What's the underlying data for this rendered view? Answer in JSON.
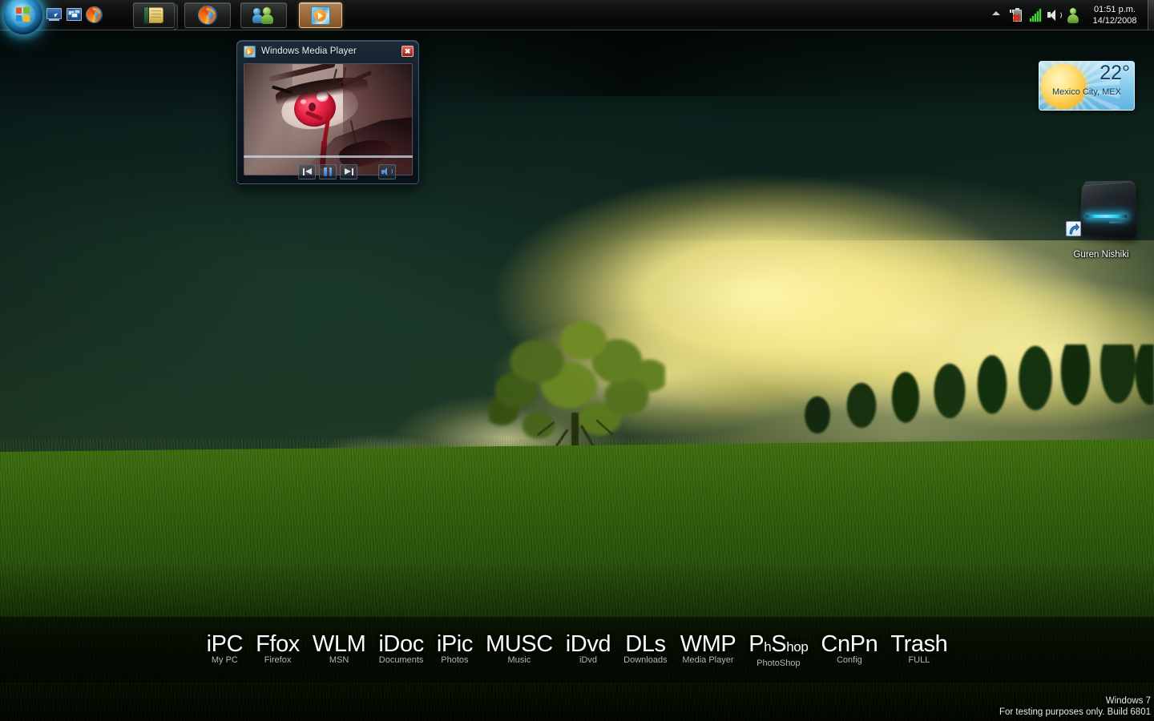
{
  "taskbar": {
    "start_button": {
      "label": "Start",
      "icon": "windows-orb-icon"
    },
    "quick_launch": [
      {
        "name": "show-desktop",
        "label": "Show Desktop",
        "icon": "show-desktop-icon"
      },
      {
        "name": "switch-windows",
        "label": "Switch between windows",
        "icon": "switch-windows-icon"
      },
      {
        "name": "firefox",
        "label": "Mozilla Firefox",
        "icon": "firefox-icon"
      }
    ],
    "buttons": [
      {
        "name": "explorer",
        "label": "Windows Explorer",
        "icon": "folder-icon",
        "active": false,
        "stacked": true
      },
      {
        "name": "firefox",
        "label": "Mozilla Firefox",
        "icon": "firefox-icon",
        "active": false,
        "stacked": false
      },
      {
        "name": "wlm",
        "label": "Windows Live Messenger",
        "icon": "messenger-icon",
        "active": false,
        "stacked": false
      },
      {
        "name": "wmp",
        "label": "Windows Media Player",
        "icon": "media-player-icon",
        "active": true,
        "stacked": false
      }
    ],
    "tray": {
      "overflow_label": "Show hidden icons",
      "icons": [
        {
          "name": "battery",
          "label": "Battery not present",
          "icon": "battery-error-icon",
          "badge": "✕"
        },
        {
          "name": "network",
          "label": "Network",
          "icon": "signal-bars-icon"
        },
        {
          "name": "volume",
          "label": "Volume",
          "icon": "speaker-icon"
        },
        {
          "name": "user",
          "label": "User account",
          "icon": "person-icon"
        }
      ]
    },
    "clock": {
      "time": "01:51 p.m.",
      "date": "14/12/2008"
    }
  },
  "media_player_window": {
    "title": "Windows Media Player",
    "title_icon": "media-player-icon",
    "close_label": "✖",
    "thumbnail_alt": "anime-eye-video-frame",
    "controls": [
      {
        "name": "previous",
        "label": "Previous",
        "icon": "previous-track-icon"
      },
      {
        "name": "pause",
        "label": "Pause",
        "icon": "pause-icon"
      },
      {
        "name": "next",
        "label": "Next",
        "icon": "next-track-icon"
      },
      {
        "name": "volume",
        "label": "Volume",
        "icon": "speaker-icon"
      }
    ]
  },
  "weather_gadget": {
    "temperature": "22°",
    "location": "Mexico City, MEX",
    "condition_icon": "sun-icon"
  },
  "desktop_icons": [
    {
      "name": "guren-nishiki",
      "label": "Guren Nishiki",
      "icon": "external-hard-drive-icon",
      "shortcut": true
    }
  ],
  "dock": {
    "items": [
      {
        "name": "my-pc",
        "title": "iPC",
        "title_small": "",
        "subtitle": "My PC"
      },
      {
        "name": "firefox",
        "title": "Ffox",
        "title_small": "",
        "subtitle": "Firefox"
      },
      {
        "name": "msn",
        "title": "WLM",
        "title_small": "",
        "subtitle": "MSN"
      },
      {
        "name": "documents",
        "title": "iDoc",
        "title_small": "",
        "subtitle": "Documents"
      },
      {
        "name": "photos",
        "title": "iPic",
        "title_small": "",
        "subtitle": "Photos"
      },
      {
        "name": "music",
        "title": "MUSC",
        "title_small": "",
        "subtitle": "Music"
      },
      {
        "name": "idvd",
        "title": "iDvd",
        "title_small": "",
        "subtitle": "iDvd"
      },
      {
        "name": "downloads",
        "title": "DLs",
        "title_small": "",
        "subtitle": "Downloads"
      },
      {
        "name": "media-player",
        "title": "WMP",
        "title_small": "",
        "subtitle": "Media Player"
      },
      {
        "name": "photoshop",
        "title": "P",
        "title_small": "h",
        "subtitle": "PhotoShop",
        "title2": "S",
        "title_small2": "hop"
      },
      {
        "name": "config",
        "title": "CnPn",
        "title_small": "",
        "subtitle": "Config"
      },
      {
        "name": "trash",
        "title": "Trash",
        "title_small": "",
        "subtitle": "FULL"
      }
    ]
  },
  "watermark": {
    "line1": "Windows  7",
    "line2": "For testing purposes only. Build 6801"
  },
  "colors": {
    "accent_cyan": "#3cbeeb",
    "taskbar_bg": "#0a0b0a",
    "active_button": "#c68848",
    "weather_sky": "#7cc6ec",
    "led_blue": "#2fd8ff"
  }
}
